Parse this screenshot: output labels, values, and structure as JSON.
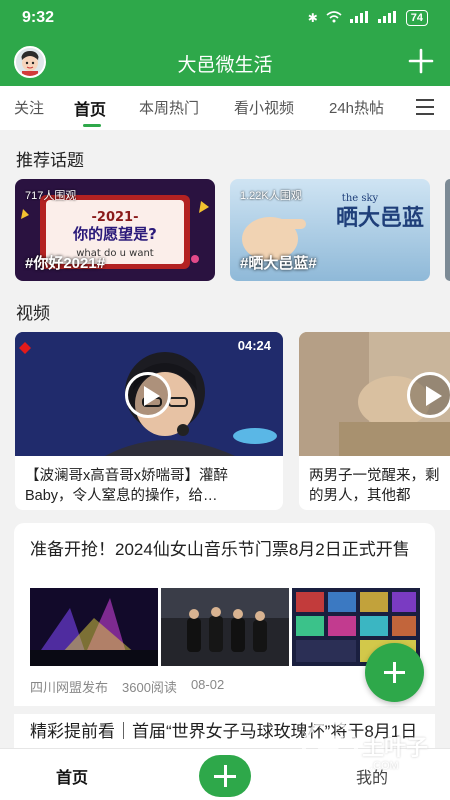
{
  "status_bar": {
    "time": "9:32",
    "battery": "74"
  },
  "app_bar": {
    "title": "大邑微生活"
  },
  "tabs": [
    {
      "label": "关注"
    },
    {
      "label": "首页"
    },
    {
      "label": "本周热门"
    },
    {
      "label": "看小视频"
    },
    {
      "label": "24h热帖"
    }
  ],
  "topics": {
    "section_title": "推荐话题",
    "items": [
      {
        "views": "717人围观",
        "tag": "#你好2021#",
        "art_line1": "-2021-",
        "art_line2": "你的愿望是?",
        "art_line3": "what do u want"
      },
      {
        "views": "1.22K人围观",
        "tag": "#晒大邑蓝#",
        "art_text": "晒大邑蓝",
        "art_sub": "the sky"
      }
    ]
  },
  "videos": {
    "section_title": "视频",
    "items": [
      {
        "duration": "04:24",
        "caption": "【波澜哥x高音哥x娇喘哥】灌醉Baby，令人窒息的操作，给…"
      },
      {
        "caption": "两男子一觉醒来，剩的男人，其他都"
      }
    ]
  },
  "news": [
    {
      "title": "准备开抢！2024仙女山音乐节门票8月2日正式开售",
      "source": "四川网盟发布",
      "reads": "3600阅读",
      "date": "08-02"
    },
    {
      "title": "精彩提前看｜首届“世界女子马球玫瑰杯”将于8月1日"
    }
  ],
  "bottom_nav": {
    "home": "首页",
    "me": "我的"
  },
  "watermark": {
    "text": "土叶子",
    "sub": ".COM"
  },
  "colors": {
    "brand_green": "#2ea84a",
    "active_tab_underline": "#2ea84a"
  }
}
